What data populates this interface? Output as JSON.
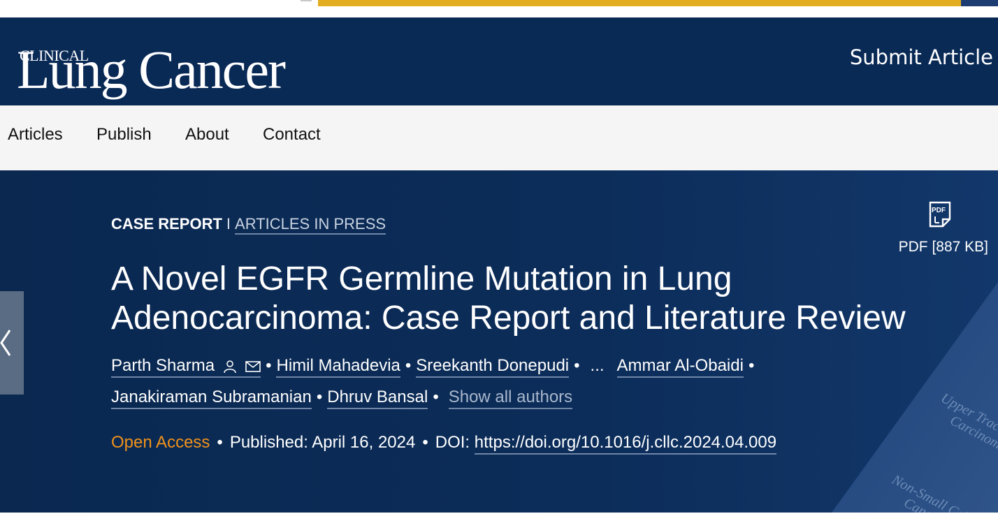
{
  "journal": {
    "name_small": "CLINICAL",
    "name_large": "Lung Cancer",
    "submit_label": "Submit Article"
  },
  "nav": {
    "items": [
      {
        "label": "Articles"
      },
      {
        "label": "Publish"
      },
      {
        "label": "About"
      },
      {
        "label": "Contact"
      }
    ]
  },
  "article": {
    "type": "CASE REPORT",
    "separator": "I",
    "status": "ARTICLES IN PRESS",
    "title": "A Novel EGFR Germline Mutation in Lung Adenocarcinoma: Case Report and Literature Review",
    "authors": [
      {
        "name": "Parth Sharma"
      },
      {
        "name": "Himil Mahadevia"
      },
      {
        "name": "Sreekanth Donepudi"
      },
      {
        "name": "Ammar Al-Obaidi"
      },
      {
        "name": "Janakiraman Subramanian"
      },
      {
        "name": "Dhruv Bansal"
      }
    ],
    "ellipsis": "...",
    "show_all": "Show all authors",
    "access": "Open Access",
    "published": "Published: April 16, 2024",
    "doi_label": "DOI:",
    "doi": "https://doi.org/10.1016/j.cllc.2024.04.009",
    "pdf_label": "PDF [887 KB]",
    "pdf_icon_text": "PDF"
  },
  "background_text": {
    "line1": "Upper Tract",
    "line2": "Carcinoma,",
    "line3": "Non-Small Cell Lung",
    "line4": "Cance"
  },
  "icons": {
    "author_person": "person-icon",
    "author_mail": "mail-icon",
    "pdf": "pdf-icon",
    "prev": "chevron-left-icon"
  },
  "colors": {
    "header_bg": "#0a2a56",
    "nav_bg": "#f5f5f5",
    "hero_bg": "#0b2b57",
    "open_access": "#f1921b",
    "link_underline": "#6f86a6",
    "banner": "#e3ad21"
  }
}
